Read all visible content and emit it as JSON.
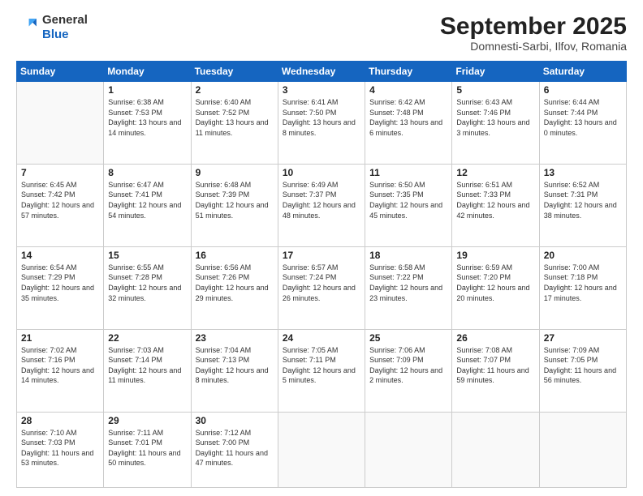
{
  "header": {
    "logo_general": "General",
    "logo_blue": "Blue",
    "month_title": "September 2025",
    "subtitle": "Domnesti-Sarbi, Ilfov, Romania"
  },
  "weekdays": [
    "Sunday",
    "Monday",
    "Tuesday",
    "Wednesday",
    "Thursday",
    "Friday",
    "Saturday"
  ],
  "weeks": [
    [
      {
        "day": "",
        "empty": true
      },
      {
        "day": "1",
        "sunrise": "6:38 AM",
        "sunset": "7:53 PM",
        "daylight": "13 hours and 14 minutes."
      },
      {
        "day": "2",
        "sunrise": "6:40 AM",
        "sunset": "7:52 PM",
        "daylight": "13 hours and 11 minutes."
      },
      {
        "day": "3",
        "sunrise": "6:41 AM",
        "sunset": "7:50 PM",
        "daylight": "13 hours and 8 minutes."
      },
      {
        "day": "4",
        "sunrise": "6:42 AM",
        "sunset": "7:48 PM",
        "daylight": "13 hours and 6 minutes."
      },
      {
        "day": "5",
        "sunrise": "6:43 AM",
        "sunset": "7:46 PM",
        "daylight": "13 hours and 3 minutes."
      },
      {
        "day": "6",
        "sunrise": "6:44 AM",
        "sunset": "7:44 PM",
        "daylight": "13 hours and 0 minutes."
      }
    ],
    [
      {
        "day": "7",
        "sunrise": "6:45 AM",
        "sunset": "7:42 PM",
        "daylight": "12 hours and 57 minutes."
      },
      {
        "day": "8",
        "sunrise": "6:47 AM",
        "sunset": "7:41 PM",
        "daylight": "12 hours and 54 minutes."
      },
      {
        "day": "9",
        "sunrise": "6:48 AM",
        "sunset": "7:39 PM",
        "daylight": "12 hours and 51 minutes."
      },
      {
        "day": "10",
        "sunrise": "6:49 AM",
        "sunset": "7:37 PM",
        "daylight": "12 hours and 48 minutes."
      },
      {
        "day": "11",
        "sunrise": "6:50 AM",
        "sunset": "7:35 PM",
        "daylight": "12 hours and 45 minutes."
      },
      {
        "day": "12",
        "sunrise": "6:51 AM",
        "sunset": "7:33 PM",
        "daylight": "12 hours and 42 minutes."
      },
      {
        "day": "13",
        "sunrise": "6:52 AM",
        "sunset": "7:31 PM",
        "daylight": "12 hours and 38 minutes."
      }
    ],
    [
      {
        "day": "14",
        "sunrise": "6:54 AM",
        "sunset": "7:29 PM",
        "daylight": "12 hours and 35 minutes."
      },
      {
        "day": "15",
        "sunrise": "6:55 AM",
        "sunset": "7:28 PM",
        "daylight": "12 hours and 32 minutes."
      },
      {
        "day": "16",
        "sunrise": "6:56 AM",
        "sunset": "7:26 PM",
        "daylight": "12 hours and 29 minutes."
      },
      {
        "day": "17",
        "sunrise": "6:57 AM",
        "sunset": "7:24 PM",
        "daylight": "12 hours and 26 minutes."
      },
      {
        "day": "18",
        "sunrise": "6:58 AM",
        "sunset": "7:22 PM",
        "daylight": "12 hours and 23 minutes."
      },
      {
        "day": "19",
        "sunrise": "6:59 AM",
        "sunset": "7:20 PM",
        "daylight": "12 hours and 20 minutes."
      },
      {
        "day": "20",
        "sunrise": "7:00 AM",
        "sunset": "7:18 PM",
        "daylight": "12 hours and 17 minutes."
      }
    ],
    [
      {
        "day": "21",
        "sunrise": "7:02 AM",
        "sunset": "7:16 PM",
        "daylight": "12 hours and 14 minutes."
      },
      {
        "day": "22",
        "sunrise": "7:03 AM",
        "sunset": "7:14 PM",
        "daylight": "12 hours and 11 minutes."
      },
      {
        "day": "23",
        "sunrise": "7:04 AM",
        "sunset": "7:13 PM",
        "daylight": "12 hours and 8 minutes."
      },
      {
        "day": "24",
        "sunrise": "7:05 AM",
        "sunset": "7:11 PM",
        "daylight": "12 hours and 5 minutes."
      },
      {
        "day": "25",
        "sunrise": "7:06 AM",
        "sunset": "7:09 PM",
        "daylight": "12 hours and 2 minutes."
      },
      {
        "day": "26",
        "sunrise": "7:08 AM",
        "sunset": "7:07 PM",
        "daylight": "11 hours and 59 minutes."
      },
      {
        "day": "27",
        "sunrise": "7:09 AM",
        "sunset": "7:05 PM",
        "daylight": "11 hours and 56 minutes."
      }
    ],
    [
      {
        "day": "28",
        "sunrise": "7:10 AM",
        "sunset": "7:03 PM",
        "daylight": "11 hours and 53 minutes."
      },
      {
        "day": "29",
        "sunrise": "7:11 AM",
        "sunset": "7:01 PM",
        "daylight": "11 hours and 50 minutes."
      },
      {
        "day": "30",
        "sunrise": "7:12 AM",
        "sunset": "7:00 PM",
        "daylight": "11 hours and 47 minutes."
      },
      {
        "day": "",
        "empty": true
      },
      {
        "day": "",
        "empty": true
      },
      {
        "day": "",
        "empty": true
      },
      {
        "day": "",
        "empty": true
      }
    ]
  ],
  "labels": {
    "sunrise": "Sunrise:",
    "sunset": "Sunset:",
    "daylight": "Daylight:"
  }
}
